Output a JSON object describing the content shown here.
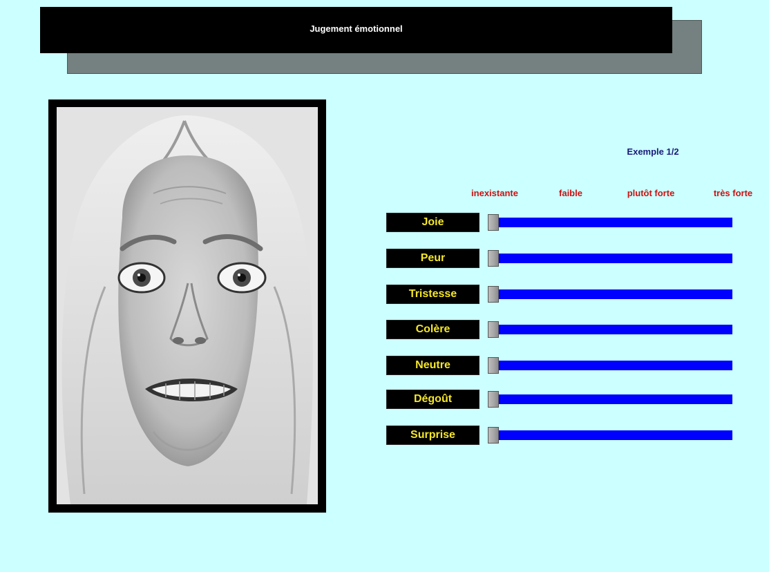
{
  "window": {
    "title": "Jugement émotionnel"
  },
  "photo": {
    "alt_semantic": "face-photo"
  },
  "example_counter": "Exemple 1/2",
  "scale_labels": [
    "inexistante",
    "faible",
    "plutôt forte",
    "très forte"
  ],
  "emotions": [
    {
      "label": "Joie",
      "value": 0
    },
    {
      "label": "Peur",
      "value": 0
    },
    {
      "label": "Tristesse",
      "value": 0
    },
    {
      "label": "Colère",
      "value": 0
    },
    {
      "label": "Neutre",
      "value": 0
    },
    {
      "label": "Dégoût",
      "value": 0
    },
    {
      "label": "Surprise",
      "value": 0
    }
  ],
  "colors": {
    "background": "#ccffff",
    "banner": "#000000",
    "label_text": "#f5e628",
    "scale_text": "#cc1111",
    "track": "#0000ff",
    "example_text": "#1a1a7a"
  }
}
